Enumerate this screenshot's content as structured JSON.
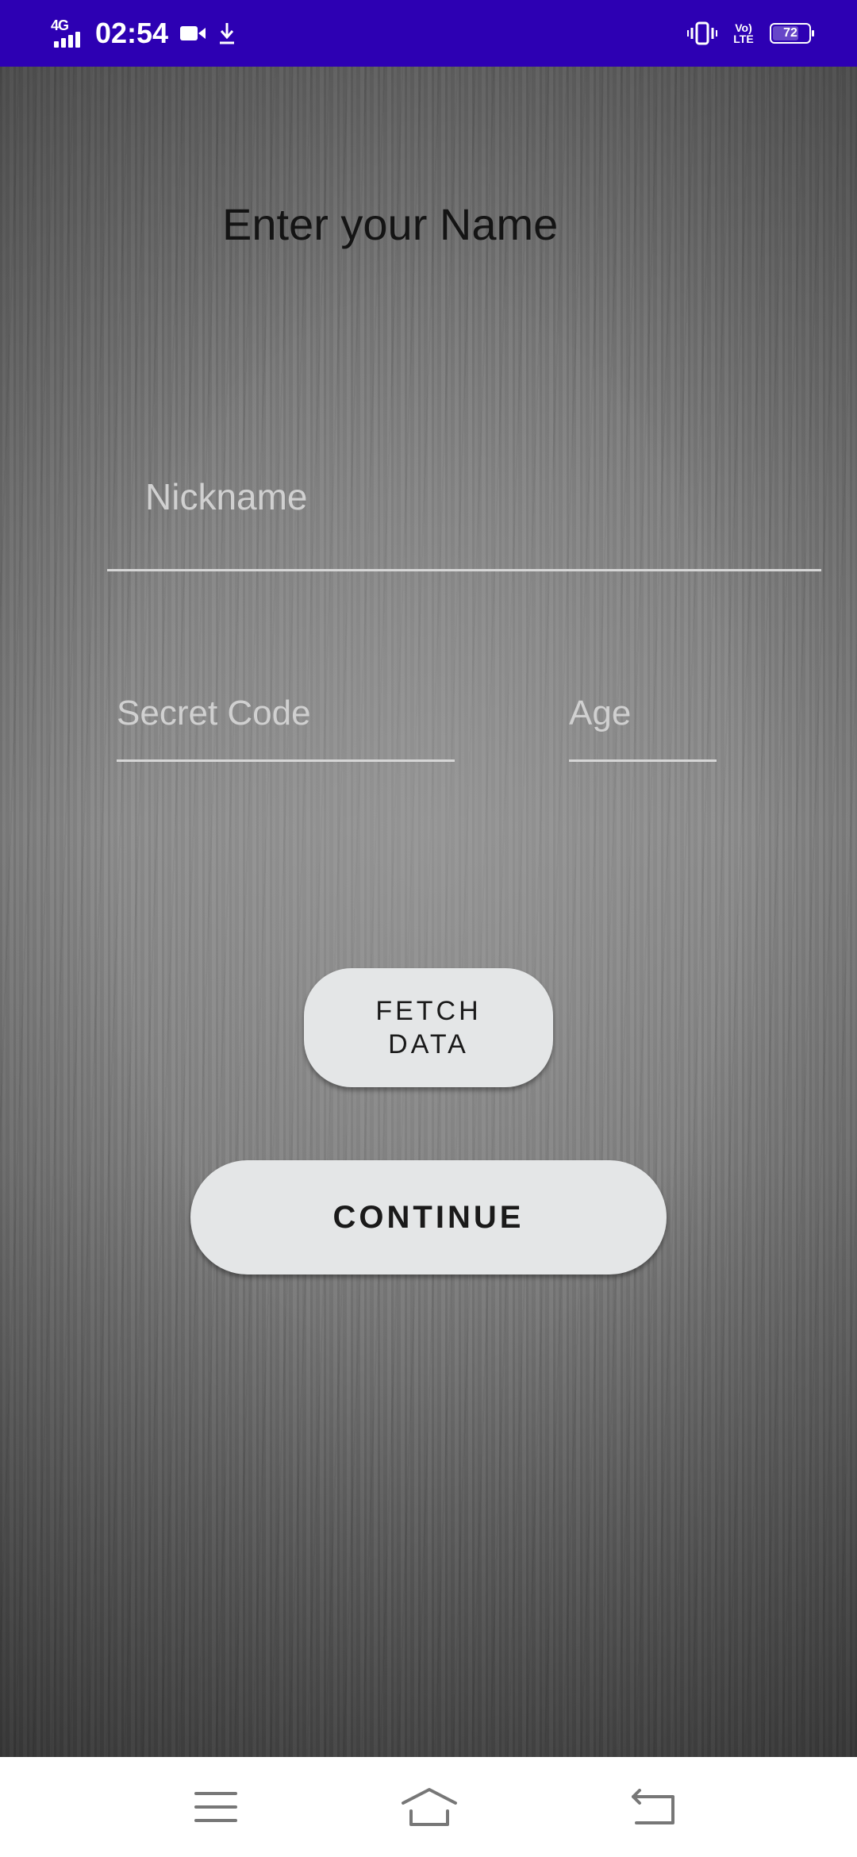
{
  "status_bar": {
    "network_type": "4G",
    "time": "02:54",
    "volte_label": "Vo) LTE",
    "battery_level": "72",
    "battery_fraction": 0.72,
    "icons": [
      "signal-icon",
      "video-camera-icon",
      "download-icon",
      "vibrate-icon",
      "volte-icon",
      "battery-icon"
    ]
  },
  "form": {
    "title": "Enter your Name",
    "nickname_placeholder": "Nickname",
    "nickname_value": "",
    "secret_code_placeholder": "Secret Code",
    "secret_code_value": "",
    "age_placeholder": "Age",
    "age_value": ""
  },
  "buttons": {
    "fetch_data": "FETCH DATA",
    "continue": "CONTINUE"
  },
  "nav_bar": {
    "icons": [
      "menu-icon",
      "home-icon",
      "back-icon"
    ]
  },
  "colors": {
    "status_bar": "#2d00b3",
    "button_bg": "#e4e6e7",
    "field_underline": "#d6d6d6",
    "title_text": "#141414"
  }
}
